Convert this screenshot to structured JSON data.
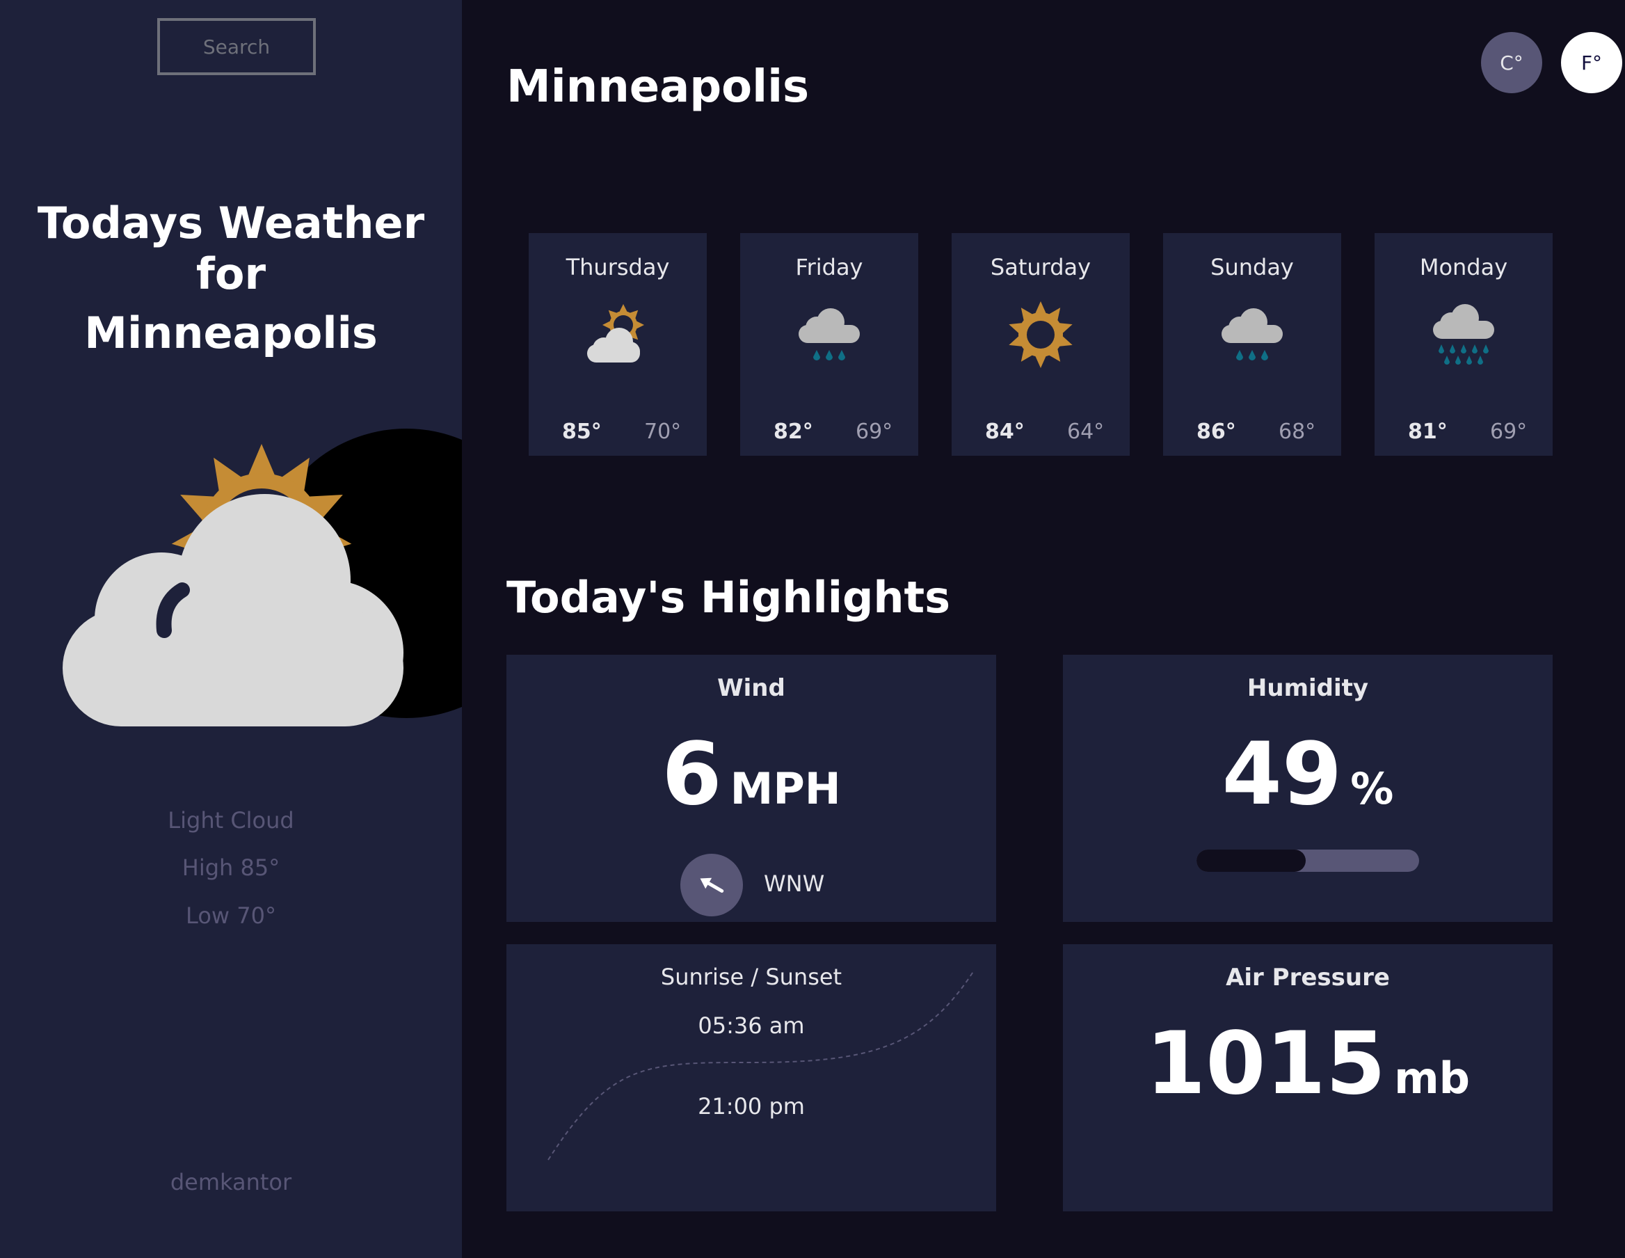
{
  "sidebar": {
    "search_label": "Search",
    "title_line1": "Todays Weather for",
    "title_line2": "Minneapolis",
    "icon": "light-cloud-icon",
    "condition": "Light Cloud",
    "high": "High 85°",
    "low": "Low 70°",
    "author": "demkantor"
  },
  "units": {
    "celsius": "C°",
    "fahrenheit": "F°"
  },
  "city": "Minneapolis",
  "forecast": [
    {
      "day": "Thursday",
      "icon": "light-cloud-icon",
      "high": "85°",
      "low": "70°"
    },
    {
      "day": "Friday",
      "icon": "light-rain-icon",
      "high": "82°",
      "low": "69°"
    },
    {
      "day": "Saturday",
      "icon": "clear-sun-icon",
      "high": "84°",
      "low": "64°"
    },
    {
      "day": "Sunday",
      "icon": "light-rain-icon",
      "high": "86°",
      "low": "68°"
    },
    {
      "day": "Monday",
      "icon": "heavy-rain-icon",
      "high": "81°",
      "low": "69°"
    }
  ],
  "highlights": {
    "title": "Today's Highlights",
    "wind": {
      "title": "Wind",
      "value": "6",
      "unit": "MPH",
      "direction": "WNW"
    },
    "humidity": {
      "title": "Humidity",
      "value": "49",
      "unit": "%",
      "percent": 49
    },
    "sun": {
      "title": "Sunrise / Sunset",
      "sunrise": "05:36 am",
      "sunset": "21:00 pm"
    },
    "pressure": {
      "title": "Air Pressure",
      "value": "1015",
      "unit": "mb"
    }
  },
  "colors": {
    "accent_sun": "#c58c35",
    "cloud": "#d9d9d9",
    "rain": "#0f6f86",
    "panel": "#1e213a",
    "background": "#100e1d"
  }
}
